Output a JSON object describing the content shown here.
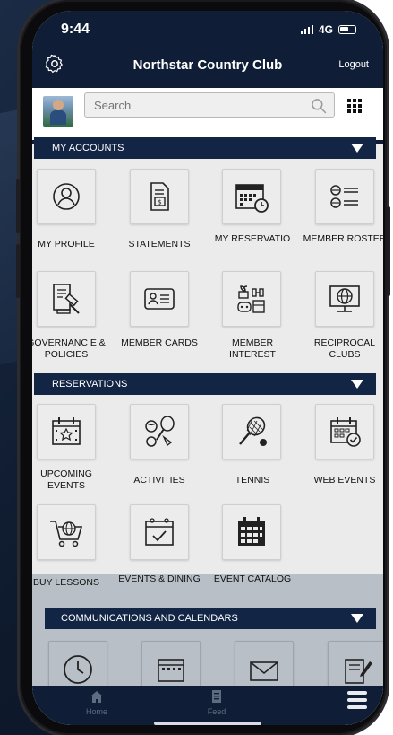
{
  "status": {
    "time": "9:44",
    "network": "4G"
  },
  "header": {
    "title": "Northstar Country Club",
    "logout": "Logout"
  },
  "search": {
    "placeholder": "Search"
  },
  "sections": {
    "my_accounts": "MY ACCOUNTS",
    "reservations": "RESERVATIONS",
    "communications": "COMMUNICATIONS AND CALENDARS"
  },
  "tiles": {
    "my_profile": "MY PROFILE",
    "statements": "STATEMENTS",
    "my_reservations": "MY RESERVATIO",
    "member_roster": "MEMBER ROSTER",
    "governance": "GOVERNANC E & POLICIES",
    "member_cards": "MEMBER CARDS",
    "member_interest": "MEMBER INTEREST",
    "reciprocal_clubs": "RECIPROCAL CLUBS",
    "upcoming_events": "UPCOMING EVENTS",
    "activities": "ACTIVITIES",
    "tennis": "TENNIS",
    "web_events": "WEB EVENTS",
    "buy_lessons": "BUY LESSONS",
    "events_dining": "EVENTS & DINING",
    "event_catalog": "EVENT CATALOG"
  },
  "tabbar": {
    "home": "Home",
    "feed": "Feed"
  },
  "colors": {
    "navy": "#0f1e36",
    "section": "#132544",
    "background": "#ebebec"
  }
}
